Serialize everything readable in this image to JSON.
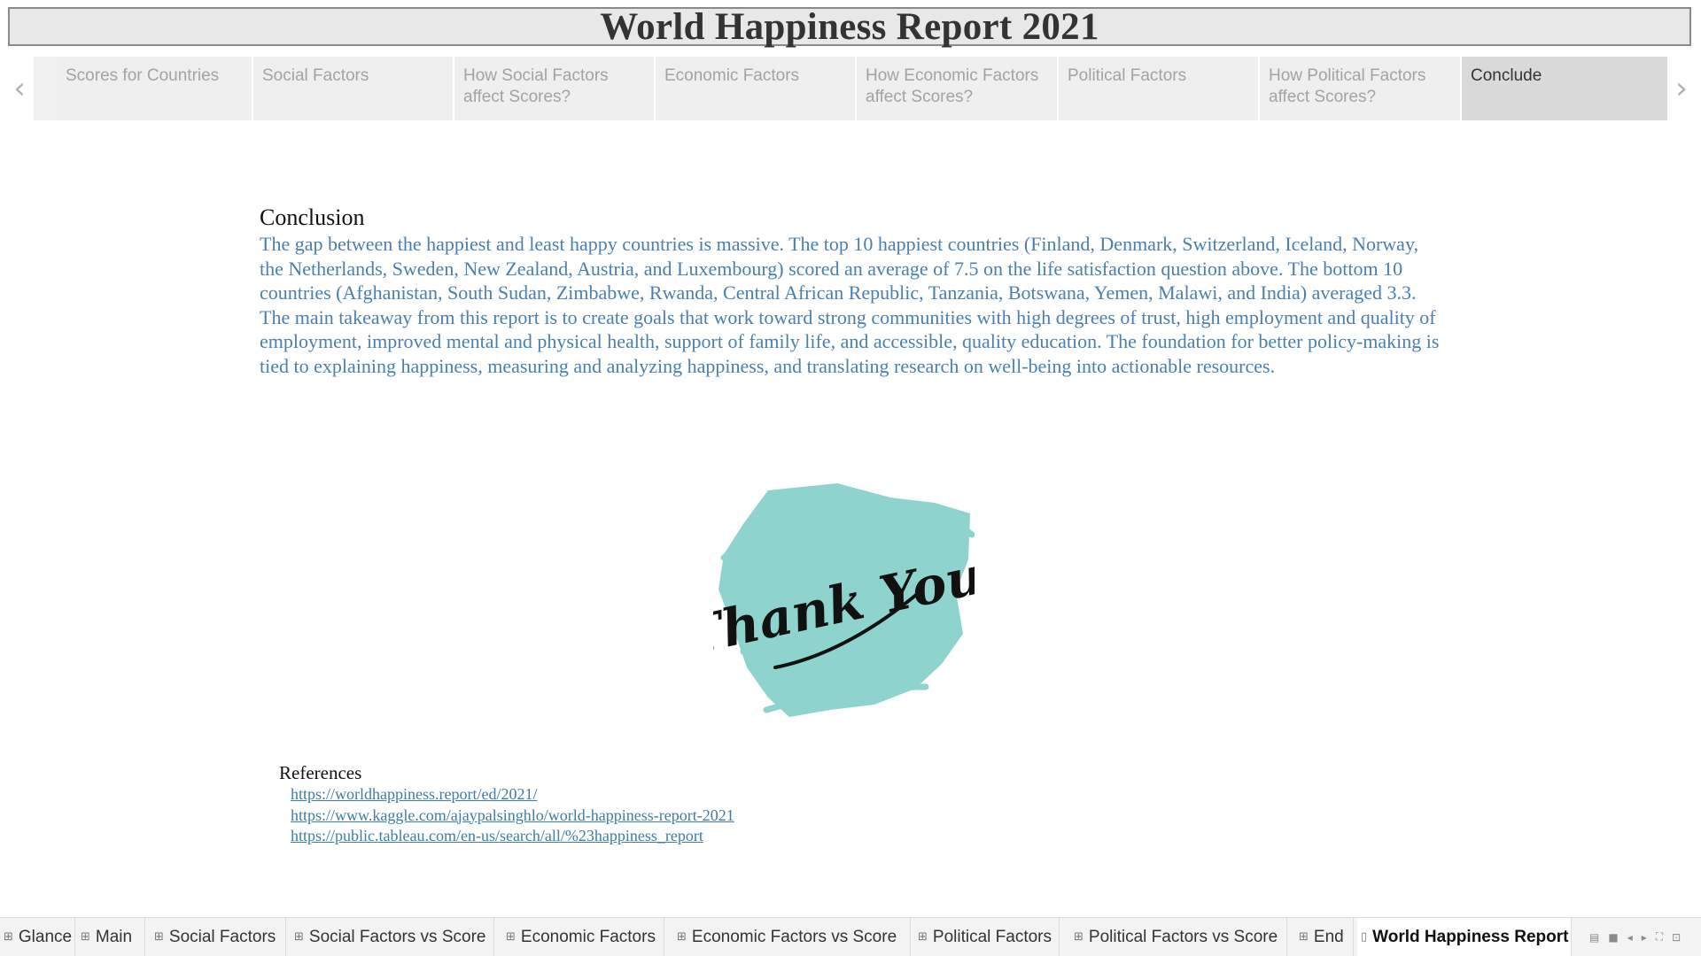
{
  "header": {
    "title": "World Happiness Report 2021"
  },
  "story_nav": {
    "prev_icon": "chevron-left-icon",
    "next_icon": "chevron-right-icon",
    "points": [
      {
        "label": "Scores for Countries"
      },
      {
        "label": "Social Factors"
      },
      {
        "label": "How Social Factors affect Scores?"
      },
      {
        "label": "Economic Factors"
      },
      {
        "label": "How Economic Factors affect Scores?"
      },
      {
        "label": "Political Factors"
      },
      {
        "label": "How Political Factors affect Scores?"
      },
      {
        "label": "Conclude"
      }
    ],
    "active_point": "Conclude"
  },
  "conclusion": {
    "heading": "Conclusion",
    "paragraphs": [
      "The gap between the happiest and least happy countries is massive. The top 10 happiest countries (Finland, Denmark, Switzerland, Iceland, Norway, the Netherlands, Sweden, New Zealand, Austria, and Luxembourg) scored an average of 7.5 on the life satisfaction question above. The bottom 10 countries (Afghanistan, South Sudan, Zimbabwe, Rwanda, Central African Republic, Tanzania, Botswana, Yemen, Malawi, and India) averaged 3.3.",
      "The main takeaway from this report is to create goals that work toward strong communities with high degrees of trust, high employment and quality of employment, improved mental and physical health, support of family life, and accessible, quality education. The foundation for better policy-making is tied to explaining happiness, measuring and analyzing happiness, and translating research on well-being into actionable resources."
    ]
  },
  "thank_you_image": {
    "text": "Thank You!",
    "brush_color": "#8fd3cf",
    "ink_color": "#111111"
  },
  "references": {
    "title": "References",
    "links": [
      "https://worldhappiness.report/ed/2021/",
      "https://www.kaggle.com/ajaypalsinghlo/world-happiness-report-2021",
      "https://public.tableau.com/en-us/search/all/%23happiness_report"
    ]
  },
  "tabs": {
    "items": [
      {
        "label": "Glance",
        "icon": "dashboard-icon"
      },
      {
        "label": "Main",
        "icon": "dashboard-icon"
      },
      {
        "label": "Social Factors",
        "icon": "dashboard-icon"
      },
      {
        "label": "Social Factors vs Score",
        "icon": "dashboard-icon"
      },
      {
        "label": "Economic Factors",
        "icon": "dashboard-icon"
      },
      {
        "label": "Economic Factors vs Score",
        "icon": "dashboard-icon"
      },
      {
        "label": "Political Factors",
        "icon": "dashboard-icon"
      },
      {
        "label": "Political Factors vs Score",
        "icon": "dashboard-icon"
      },
      {
        "label": "End",
        "icon": "dashboard-icon"
      },
      {
        "label": "World Happiness Report",
        "icon": "story-icon"
      }
    ],
    "active": "World Happiness Report",
    "controls": [
      "film-strip-icon",
      "tab-view-icon",
      "scroll-left-icon",
      "scroll-right-icon",
      "fit-icon",
      "present-icon"
    ]
  },
  "colors": {
    "body_text": "#4a7fb0",
    "link": "#3d7da7",
    "active_point_bg": "#d9d9d9"
  }
}
